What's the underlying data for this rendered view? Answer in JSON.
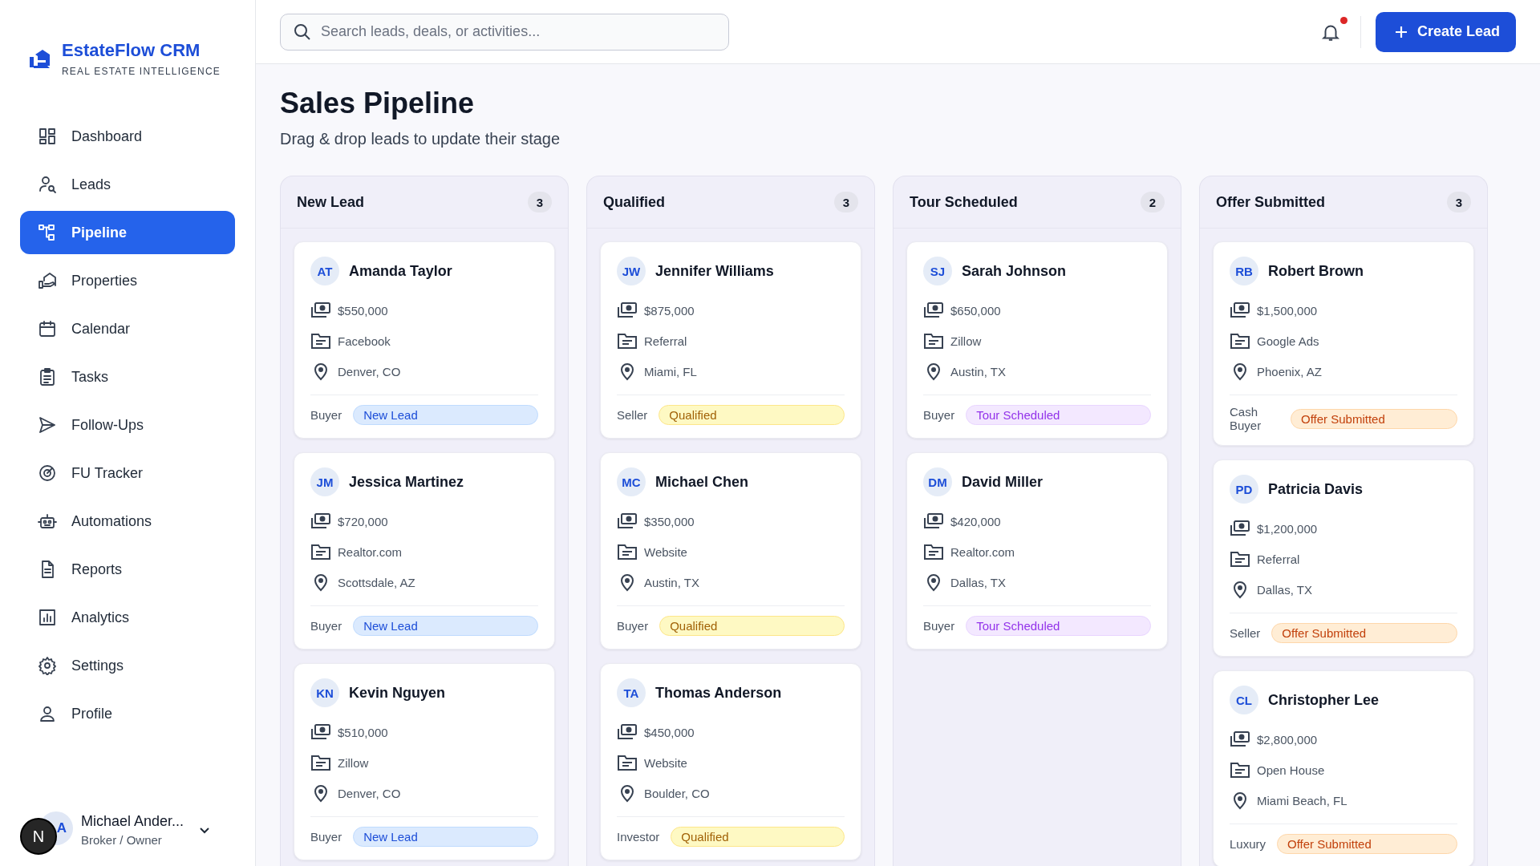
{
  "brand": {
    "name": "EstateFlow CRM",
    "tagline": "REAL ESTATE INTELLIGENCE"
  },
  "nav": [
    {
      "label": "Dashboard",
      "selected": false
    },
    {
      "label": "Leads",
      "selected": false
    },
    {
      "label": "Pipeline",
      "selected": true
    },
    {
      "label": "Properties",
      "selected": false
    },
    {
      "label": "Calendar",
      "selected": false
    },
    {
      "label": "Tasks",
      "selected": false
    },
    {
      "label": "Follow-Ups",
      "selected": false
    },
    {
      "label": "FU Tracker",
      "selected": false
    },
    {
      "label": "Automations",
      "selected": false
    },
    {
      "label": "Reports",
      "selected": false
    },
    {
      "label": "Analytics",
      "selected": false
    },
    {
      "label": "Settings",
      "selected": false
    },
    {
      "label": "Profile",
      "selected": false
    }
  ],
  "user": {
    "initials": "A",
    "name": "Michael Ander...",
    "role": "Broker / Owner",
    "overlay_badge": "N"
  },
  "search": {
    "placeholder": "Search leads, deals, or activities..."
  },
  "notifications": {
    "unread": true
  },
  "create_button": {
    "label": "Create Lead"
  },
  "page": {
    "title": "Sales Pipeline",
    "subtitle": "Drag & drop leads to update their stage"
  },
  "columns": [
    {
      "title": "New Lead",
      "count": "3",
      "cards": [
        {
          "initials": "AT",
          "name": "Amanda Taylor",
          "price": "$550,000",
          "source": "Facebook",
          "location": "Denver, CO",
          "type": "Buyer",
          "stage": "New Lead",
          "kind": "new"
        },
        {
          "initials": "JM",
          "name": "Jessica Martinez",
          "price": "$720,000",
          "source": "Realtor.com",
          "location": "Scottsdale, AZ",
          "type": "Buyer",
          "stage": "New Lead",
          "kind": "new"
        },
        {
          "initials": "KN",
          "name": "Kevin Nguyen",
          "price": "$510,000",
          "source": "Zillow",
          "location": "Denver, CO",
          "type": "Buyer",
          "stage": "New Lead",
          "kind": "new"
        }
      ]
    },
    {
      "title": "Qualified",
      "count": "3",
      "cards": [
        {
          "initials": "JW",
          "name": "Jennifer Williams",
          "price": "$875,000",
          "source": "Referral",
          "location": "Miami, FL",
          "type": "Seller",
          "stage": "Qualified",
          "kind": "qualified"
        },
        {
          "initials": "MC",
          "name": "Michael Chen",
          "price": "$350,000",
          "source": "Website",
          "location": "Austin, TX",
          "type": "Buyer",
          "stage": "Qualified",
          "kind": "qualified"
        },
        {
          "initials": "TA",
          "name": "Thomas Anderson",
          "price": "$450,000",
          "source": "Website",
          "location": "Boulder, CO",
          "type": "Investor",
          "stage": "Qualified",
          "kind": "qualified"
        }
      ]
    },
    {
      "title": "Tour Scheduled",
      "count": "2",
      "cards": [
        {
          "initials": "SJ",
          "name": "Sarah Johnson",
          "price": "$650,000",
          "source": "Zillow",
          "location": "Austin, TX",
          "type": "Buyer",
          "stage": "Tour Scheduled",
          "kind": "tour"
        },
        {
          "initials": "DM",
          "name": "David Miller",
          "price": "$420,000",
          "source": "Realtor.com",
          "location": "Dallas, TX",
          "type": "Buyer",
          "stage": "Tour Scheduled",
          "kind": "tour"
        }
      ]
    },
    {
      "title": "Offer Submitted",
      "count": "3",
      "cards": [
        {
          "initials": "RB",
          "name": "Robert Brown",
          "price": "$1,500,000",
          "source": "Google Ads",
          "location": "Phoenix, AZ",
          "type": "Cash Buyer",
          "stage": "Offer Submitted",
          "kind": "offer"
        },
        {
          "initials": "PD",
          "name": "Patricia Davis",
          "price": "$1,200,000",
          "source": "Referral",
          "location": "Dallas, TX",
          "type": "Seller",
          "stage": "Offer Submitted",
          "kind": "offer"
        },
        {
          "initials": "CL",
          "name": "Christopher Lee",
          "price": "$2,800,000",
          "source": "Open House",
          "location": "Miami Beach, FL",
          "type": "Luxury",
          "stage": "Offer Submitted",
          "kind": "offer"
        }
      ]
    }
  ]
}
